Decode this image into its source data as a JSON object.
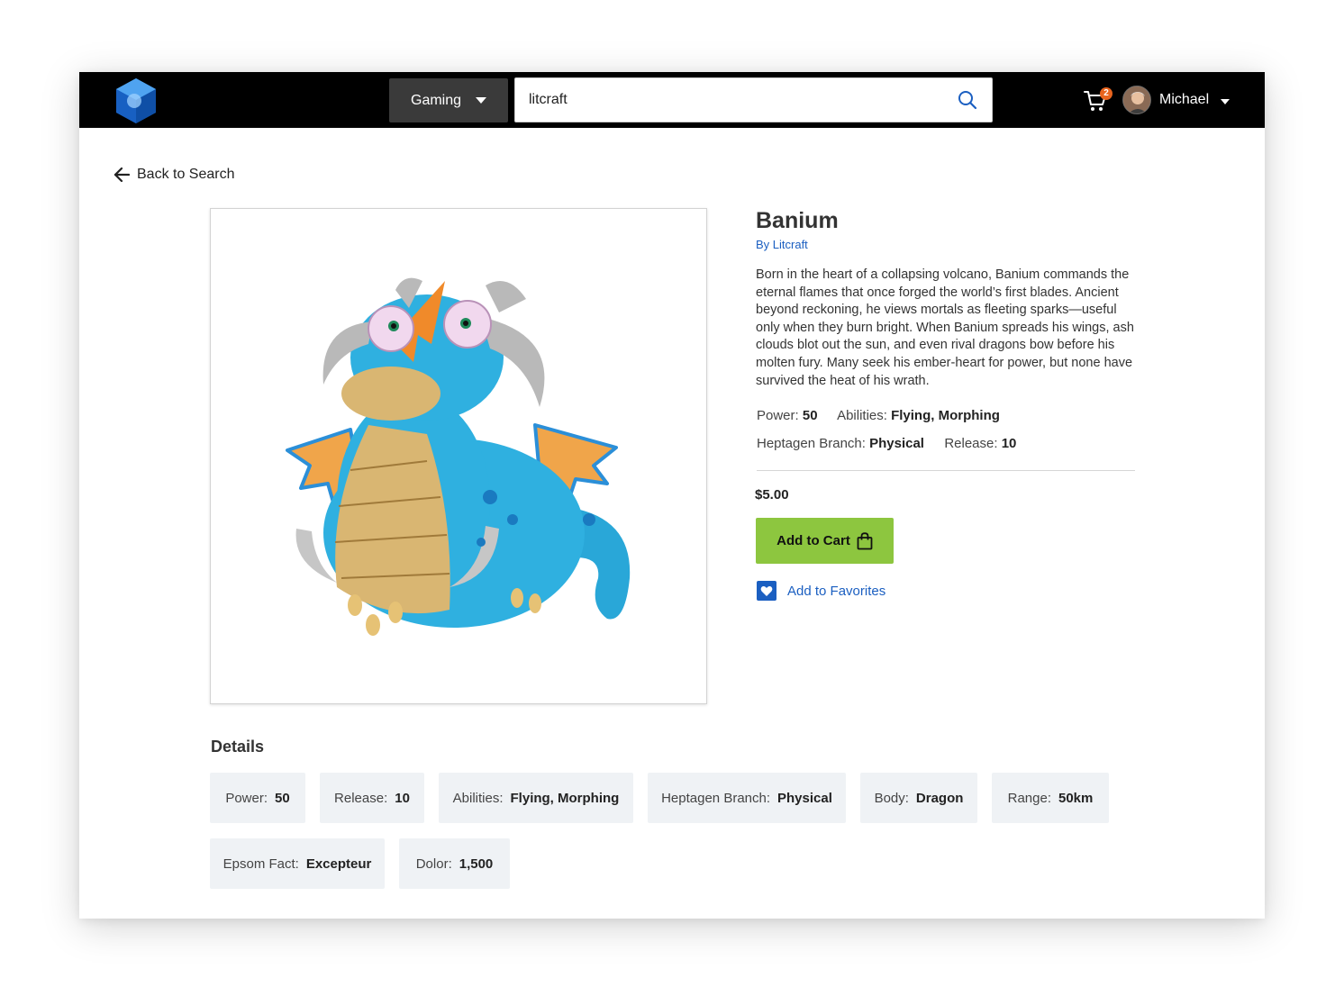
{
  "header": {
    "category": "Gaming",
    "search_value": "litcraft",
    "cart_count": "2",
    "user_name": "Michael"
  },
  "nav": {
    "back_label": "Back to Search"
  },
  "product": {
    "title": "Banium",
    "byline": "By Litcraft",
    "description": "Born in the heart of a collapsing volcano, Banium commands the eternal flames that once forged the world’s first blades. Ancient beyond reckoning, he views mortals as fleeting sparks—useful only when they burn bright. When Banium spreads his wings, ash clouds blot out the sun, and even rival dragons bow before his molten fury. Many seek his ember-heart for power, but none have survived the heat of his wrath.",
    "specs": {
      "power_label": "Power:",
      "power_value": "50",
      "abilities_label": "Abilities:",
      "abilities_value": "Flying, Morphing",
      "branch_label": "Heptagen Branch:",
      "branch_value": "Physical",
      "release_label": "Release:",
      "release_value": "10"
    },
    "price": "$5.00",
    "add_to_cart_label": "Add to Cart",
    "add_to_favorites_label": "Add to Favorites"
  },
  "details": {
    "title": "Details",
    "items": [
      {
        "label": "Power:",
        "value": "50"
      },
      {
        "label": "Release:",
        "value": "10"
      },
      {
        "label": "Abilities:",
        "value": "Flying, Morphing"
      },
      {
        "label": "Heptagen Branch:",
        "value": "Physical"
      },
      {
        "label": "Body:",
        "value": "Dragon"
      },
      {
        "label": "Range:",
        "value": "50km"
      },
      {
        "label": "Epsom Fact:",
        "value": "Excepteur"
      },
      {
        "label": "Dolor:",
        "value": "1,500"
      }
    ]
  },
  "colors": {
    "topbar": "#000000",
    "accent_green": "#8dc63f",
    "link_blue": "#1b5fc1",
    "badge_orange": "#e8641e",
    "chip_bg": "#eff2f5"
  },
  "icons": [
    "logo-cube-icon",
    "chevron-down-icon",
    "search-icon",
    "cart-icon",
    "arrow-left-icon",
    "shopping-bag-icon",
    "heart-icon"
  ]
}
